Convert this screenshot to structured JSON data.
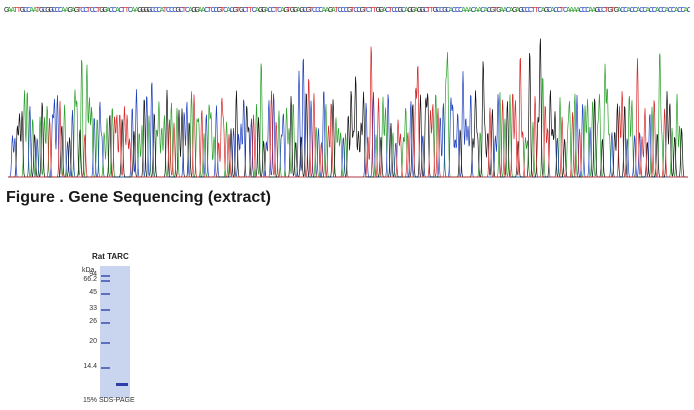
{
  "sequence_strip": {
    "text": "GAATTGCCAATGCGGCCCAAGAGTCCTCCTGGACCACTTCAAGGGGCCCATCCCGCTCAGGAACTCCGTCACGTGCTTCAGGACCTCAGTGGAGCGTCCCAAGATCCCGTCCGTCTTGGACTCCGCAGGAGGCTTGCCGCACCCAAACAACACGTGAACAGAGCCCTTCAGCACCTCAAAACCCAAGCCTGTGACCACCACCACCACCACCACCAC",
    "colors": {
      "A": "#2ca02c",
      "C": "#1f3fbf",
      "G": "#222222",
      "T": "#d62728"
    }
  },
  "chromatogram": {
    "trace_colors": {
      "A": "#2ca02c",
      "C": "#1f3fbf",
      "G": "#111111",
      "T": "#d62728"
    }
  },
  "caption": "Figure . Gene Sequencing (extract)",
  "gel": {
    "title": "Rat TARC",
    "unit_label": "kDa",
    "markers": [
      "94",
      "66.2",
      "45",
      "33",
      "26",
      "20",
      "14.4"
    ],
    "footer": "15% SDS-PAGE"
  }
}
